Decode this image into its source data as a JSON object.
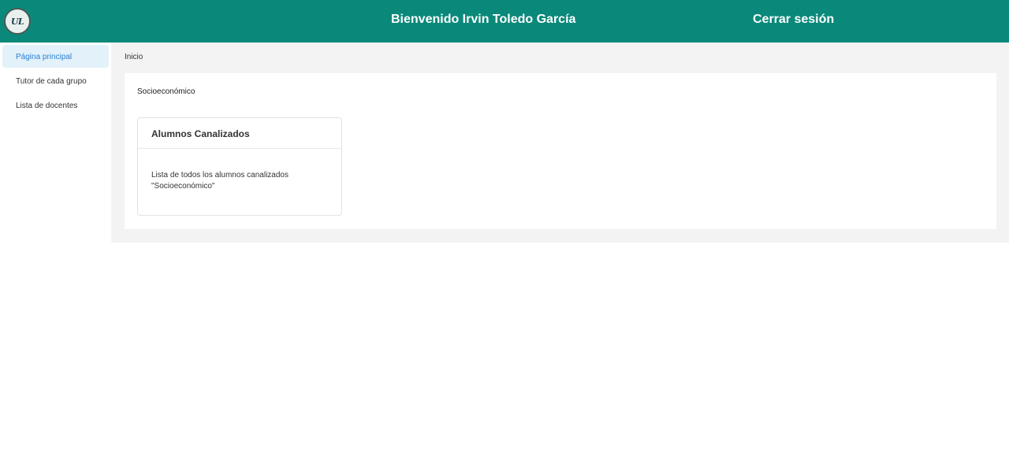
{
  "header": {
    "logo_text": "UL",
    "welcome": "Bienvenido Irvin Toledo García",
    "logout": "Cerrar sesión"
  },
  "sidebar": {
    "items": [
      {
        "label": "Página principal",
        "active": true
      },
      {
        "label": "Tutor de cada grupo",
        "active": false
      },
      {
        "label": "Lista de docentes",
        "active": false
      }
    ]
  },
  "main": {
    "breadcrumb": "Inicio",
    "section_title": "Socioeconómico",
    "card": {
      "title": "Alumnos Canalizados",
      "description_line1": "Lista de todos los alumnos canalizados",
      "description_line2": "\"Socioeconómico\""
    }
  },
  "colors": {
    "header_bg": "#0a897a",
    "active_item_bg": "#e3f1fb",
    "active_item_text": "#2a7fd0",
    "content_bg": "#f3f3f3"
  }
}
